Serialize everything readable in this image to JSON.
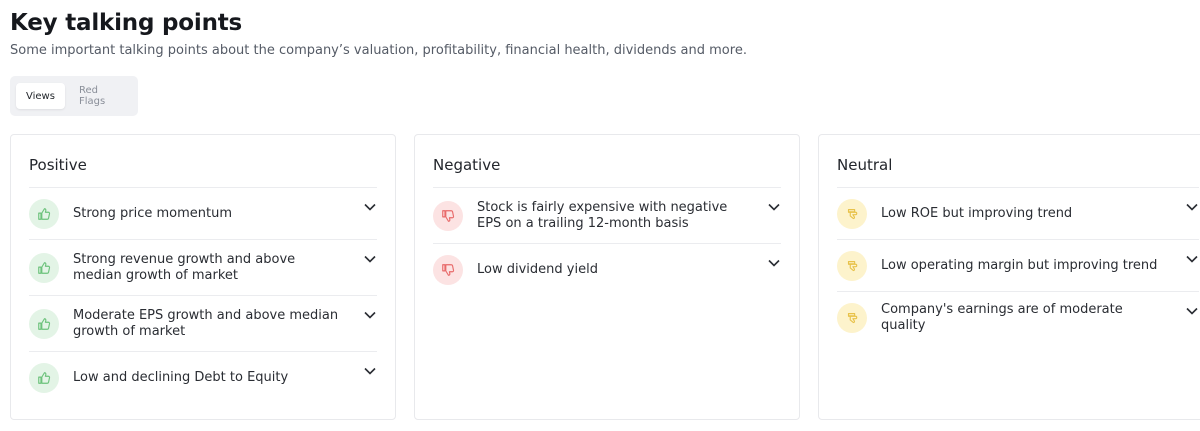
{
  "header": {
    "title": "Key talking points",
    "subtitle": "Some important talking points about the company’s valuation, profitability, financial health, dividends and more."
  },
  "tabs": [
    {
      "label": "Views",
      "active": true
    },
    {
      "label": "Red Flags",
      "active": false
    }
  ],
  "colors": {
    "positive_bg": "#e3f4e6",
    "positive_icon": "#6cc27b",
    "negative_bg": "#fce3e3",
    "negative_icon": "#e86a6a",
    "neutral_bg": "#fdf3cc",
    "neutral_icon": "#e8c24a"
  },
  "cards": [
    {
      "title": "Positive",
      "icon": "thumbs-up-icon",
      "items": [
        {
          "text": "Strong price momentum"
        },
        {
          "text": "Strong revenue growth and above median growth of market"
        },
        {
          "text": "Moderate EPS growth and above median growth of market"
        },
        {
          "text": "Low and declining Debt to Equity"
        }
      ]
    },
    {
      "title": "Negative",
      "icon": "thumbs-down-icon",
      "items": [
        {
          "text": "Stock is fairly expensive with negative EPS on a trailing 12-month basis"
        },
        {
          "text": "Low dividend yield"
        }
      ]
    },
    {
      "title": "Neutral",
      "icon": "thumb-sideways-icon",
      "items": [
        {
          "text": "Low ROE but improving trend"
        },
        {
          "text": "Low operating margin but improving trend"
        },
        {
          "text": "Company's earnings are of moderate quality"
        }
      ]
    }
  ]
}
